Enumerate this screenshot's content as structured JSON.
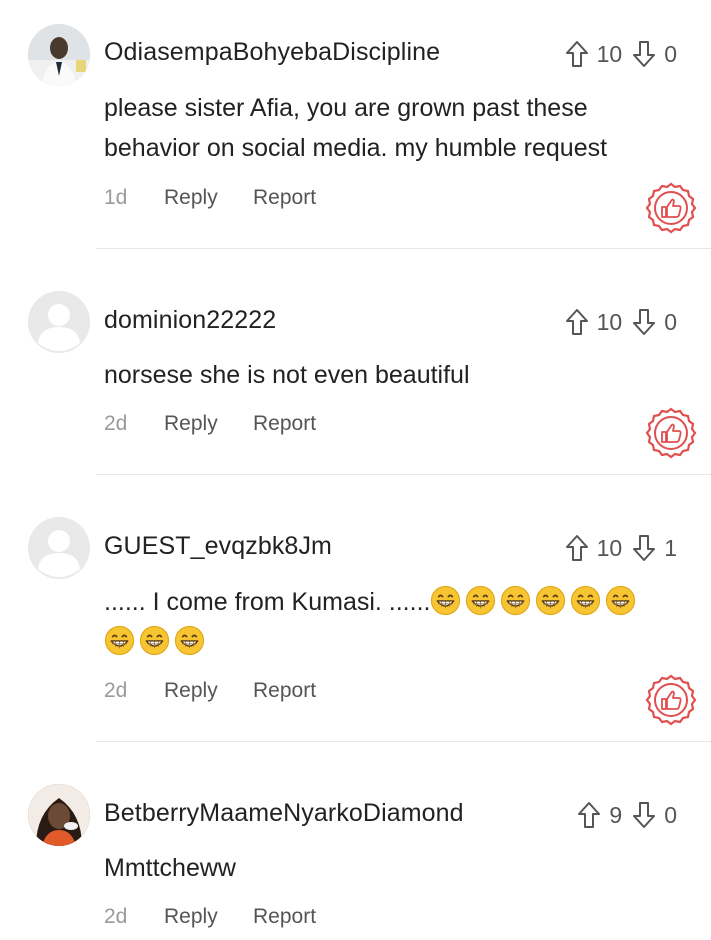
{
  "comments": [
    {
      "username": "OdiasempaBohyebaDiscipline",
      "upvotes": "10",
      "downvotes": "0",
      "text_lines": [
        "please sister Afia, you are grown past these",
        "behavior on social media. my humble request"
      ],
      "time": "1d",
      "reply_label": "Reply",
      "report_label": "Report",
      "avatar": "photo"
    },
    {
      "username": "dominion22222",
      "upvotes": "10",
      "downvotes": "0",
      "text_lines": [
        "norsese she is not even beautiful"
      ],
      "time": "2d",
      "reply_label": "Reply",
      "report_label": "Report",
      "avatar": "default"
    },
    {
      "username": "GUEST_evqzbk8Jm",
      "upvotes": "10",
      "downvotes": "1",
      "text_lines": [
        "...... I come from Kumasi. ......"
      ],
      "emoji_count_line1": 6,
      "emoji_count_line2": 3,
      "emoji": "😁",
      "time": "2d",
      "reply_label": "Reply",
      "report_label": "Report",
      "avatar": "default"
    },
    {
      "username": "BetberryMaameNyarkoDiamond",
      "upvotes": "9",
      "downvotes": "0",
      "text_lines": [
        "Mmttcheww"
      ],
      "time": "2d",
      "reply_label": "Reply",
      "report_label": "Report",
      "avatar": "photo"
    }
  ],
  "colors": {
    "like_badge": "#e04f4f",
    "text": "#222222",
    "muted": "#9a9a9a",
    "icons": "#555555"
  },
  "icons": [
    "upvote-arrow-icon",
    "downvote-arrow-icon",
    "thumbs-up-icon"
  ]
}
